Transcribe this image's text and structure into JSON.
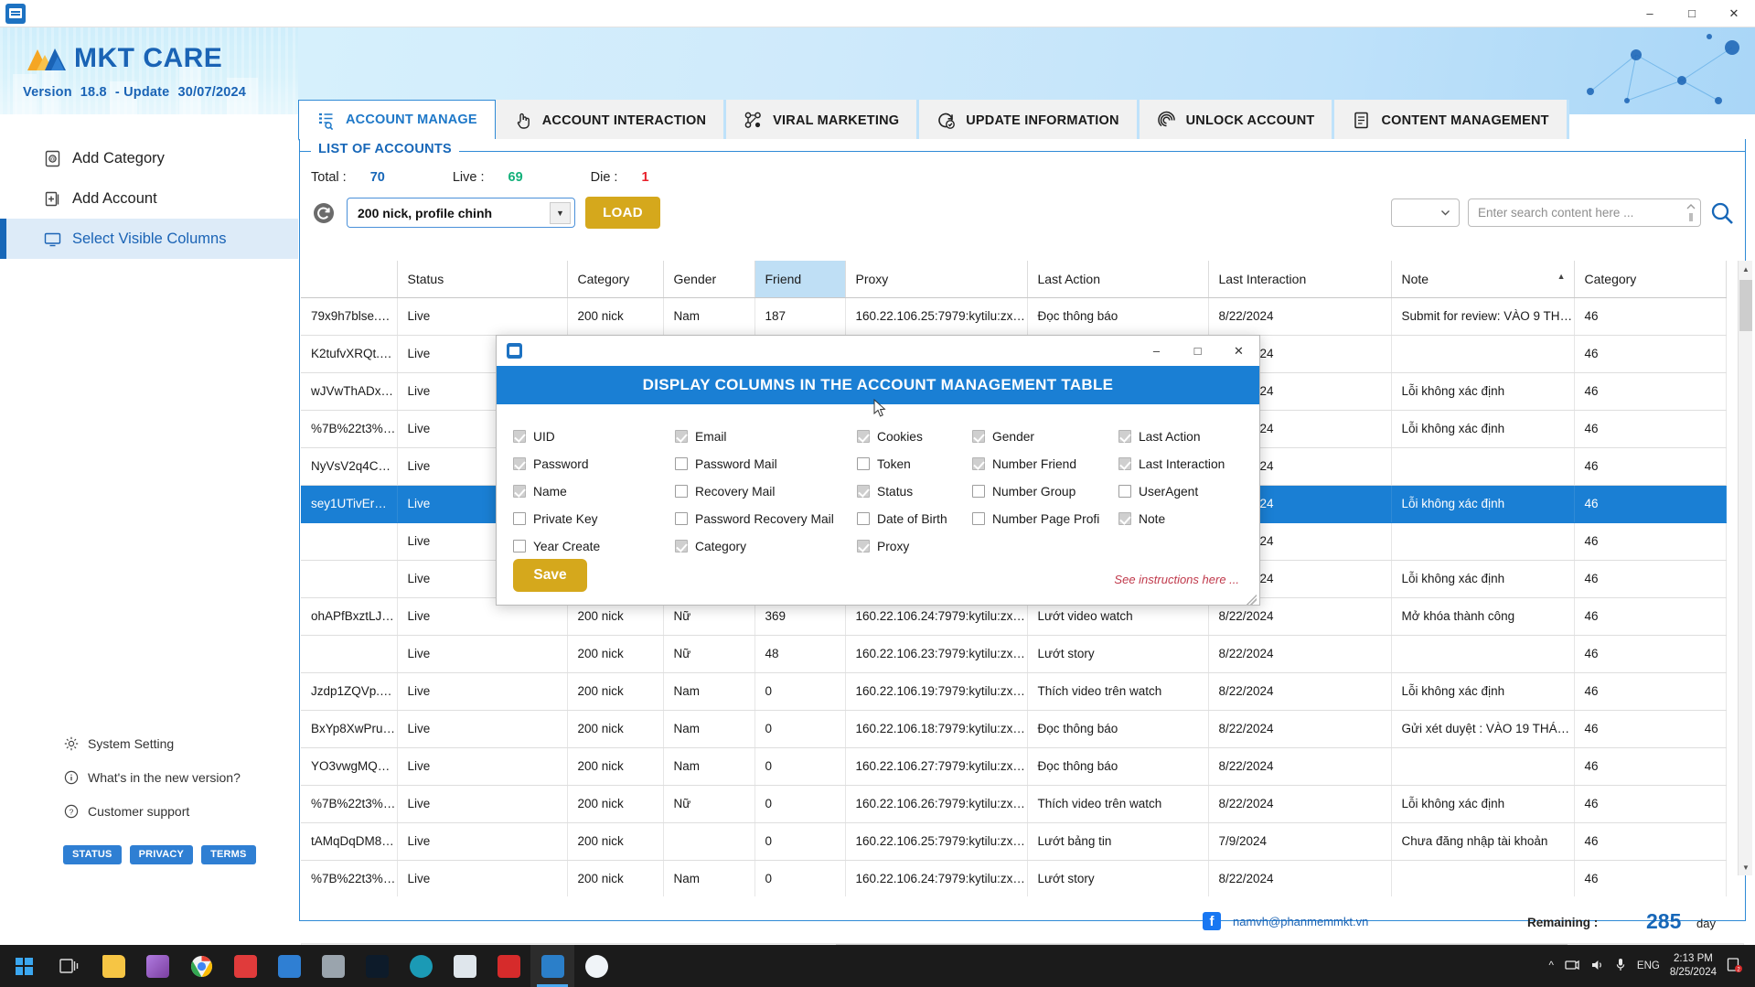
{
  "window": {
    "minimize": "–",
    "maximize": "□",
    "close": "✕"
  },
  "brand": {
    "name": "MKT CARE",
    "version_label": "Version",
    "version_number": "18.8",
    "update_label": "- Update",
    "update_date": "30/07/2024"
  },
  "sidebar": {
    "items": [
      {
        "label": "Add Category",
        "icon": "address-book-icon",
        "active": false
      },
      {
        "label": "Add Account",
        "icon": "add-box-icon",
        "active": false
      },
      {
        "label": "Select Visible Columns",
        "icon": "monitor-icon",
        "active": true
      }
    ],
    "bottom_items": [
      {
        "label": "System Setting",
        "icon": "gear-icon"
      },
      {
        "label": "What's in the new version?",
        "icon": "info-icon"
      },
      {
        "label": "Customer support",
        "icon": "question-icon"
      }
    ],
    "pills": [
      "STATUS",
      "PRIVACY",
      "TERMS"
    ]
  },
  "tabs": [
    {
      "label": "ACCOUNT MANAGE",
      "icon": "list-search-icon",
      "active": true
    },
    {
      "label": "ACCOUNT INTERACTION",
      "icon": "hand-pointer-icon",
      "active": false
    },
    {
      "label": "VIRAL MARKETING",
      "icon": "network-nodes-icon",
      "active": false
    },
    {
      "label": "UPDATE INFORMATION",
      "icon": "refresh-check-icon",
      "active": false
    },
    {
      "label": "UNLOCK ACCOUNT",
      "icon": "fingerprint-icon",
      "active": false
    },
    {
      "label": "CONTENT MANAGEMENT",
      "icon": "document-lines-icon",
      "active": false
    }
  ],
  "panel": {
    "legend": "LIST OF ACCOUNTS",
    "stats": {
      "total_label": "Total :",
      "total_value": "70",
      "live_label": "Live :",
      "live_value": "69",
      "die_label": "Die :",
      "die_value": "1"
    },
    "toolbar": {
      "refresh_icon": "refresh-icon",
      "category_select_value": "200 nick, profile chinh",
      "load_button": "LOAD"
    },
    "search": {
      "filter_value": "",
      "placeholder": "Enter search content here ...",
      "search_icon": "search-icon"
    }
  },
  "grid": {
    "columns": [
      "",
      "Status",
      "Category",
      "Gender",
      "Friend",
      "Proxy",
      "Last Action",
      "Last Interaction",
      "Note",
      "Category"
    ],
    "sorted_column": "Note",
    "sort_direction": "▲",
    "highlighted_column": "Friend",
    "rows": [
      {
        "uid": "79x9h7blse.AWWn...",
        "status": "Live",
        "category": "200 nick",
        "gender": "Nam",
        "friend": "187",
        "proxy": "160.22.106.25:7979:kytilu:zxwvj...",
        "last_action": "Đọc thông báo",
        "last_interaction": "8/22/2024",
        "note": "Submit for review: VÀO 9 THÁ...",
        "category2": "46",
        "selected": false
      },
      {
        "uid": "K2tufvXRQt.AWUP...",
        "status": "Live",
        "category": "",
        "gender": "",
        "friend": "",
        "proxy": "",
        "last_action": "",
        "last_interaction": "8/22/2024",
        "note": "",
        "category2": "46",
        "selected": false
      },
      {
        "uid": "wJVwThADx.AWV1...",
        "status": "Live",
        "category": "",
        "gender": "",
        "friend": "",
        "proxy": "",
        "last_action": "",
        "last_interaction": "8/22/2024",
        "note": "Lỗi không xác định",
        "category2": "46",
        "selected": false
      },
      {
        "uid": "%7B%22t3%22%3...",
        "status": "Live",
        "category": "",
        "gender": "",
        "friend": "",
        "proxy": "",
        "last_action": "",
        "last_interaction": "8/22/2024",
        "note": "Lỗi không xác định",
        "category2": "46",
        "selected": false
      },
      {
        "uid": "NyVsV2q4CR4.AW...",
        "status": "Live",
        "category": "",
        "gender": "",
        "friend": "",
        "proxy": "",
        "last_action": "",
        "last_interaction": "8/22/2024",
        "note": "",
        "category2": "46",
        "selected": false
      },
      {
        "uid": "sey1UTivErD.AWW...",
        "status": "Live",
        "category": "",
        "gender": "",
        "friend": "",
        "proxy": "",
        "last_action": "",
        "last_interaction": "8/22/2024",
        "note": "Lỗi không xác định",
        "category2": "46",
        "selected": true
      },
      {
        "uid": "",
        "status": "Live",
        "category": "",
        "gender": "",
        "friend": "",
        "proxy": "",
        "last_action": "",
        "last_interaction": "8/22/2024",
        "note": "",
        "category2": "46",
        "selected": false
      },
      {
        "uid": "",
        "status": "Live",
        "category": "",
        "gender": "",
        "friend": "",
        "proxy": "",
        "last_action": "",
        "last_interaction": "8/22/2024",
        "note": "Lỗi không xác định",
        "category2": "46",
        "selected": false
      },
      {
        "uid": "ohAPfBxztLJ.AWXz...",
        "status": "Live",
        "category": "200 nick",
        "gender": "Nữ",
        "friend": "369",
        "proxy": "160.22.106.24:7979:kytilu:zxwvj...",
        "last_action": "Lướt video watch",
        "last_interaction": "8/22/2024",
        "note": "Mở khóa thành công",
        "category2": "46",
        "selected": false
      },
      {
        "uid": "",
        "status": "Live",
        "category": "200 nick",
        "gender": "Nữ",
        "friend": "48",
        "proxy": "160.22.106.23:7979:kytilu:zxwvj...",
        "last_action": "Lướt story",
        "last_interaction": "8/22/2024",
        "note": "",
        "category2": "46",
        "selected": false
      },
      {
        "uid": "Jzdp1ZQVp.AWWk...",
        "status": "Live",
        "category": "200 nick",
        "gender": "Nam",
        "friend": "0",
        "proxy": "160.22.106.19:7979:kytilu:zxwvj...",
        "last_action": "Thích video trên watch",
        "last_interaction": "8/22/2024",
        "note": "Lỗi không xác định",
        "category2": "46",
        "selected": false
      },
      {
        "uid": "BxYp8XwPruv3A%3...",
        "status": "Live",
        "category": "200 nick",
        "gender": "Nam",
        "friend": "0",
        "proxy": "160.22.106.18:7979:kytilu:zxwvj...",
        "last_action": "Đọc thông báo",
        "last_interaction": "8/22/2024",
        "note": "Gửi xét duyệt : VÀO 19 THÁNG...",
        "category2": "46",
        "selected": false
      },
      {
        "uid": "YO3vwgMQa.AWV...",
        "status": "Live",
        "category": "200 nick",
        "gender": "Nam",
        "friend": "0",
        "proxy": "160.22.106.27:7979:kytilu:zxwvj...",
        "last_action": "Đọc thông báo",
        "last_interaction": "8/22/2024",
        "note": "",
        "category2": "46",
        "selected": false
      },
      {
        "uid": "%7B%22t3%22%3...",
        "status": "Live",
        "category": "200 nick",
        "gender": "Nữ",
        "friend": "0",
        "proxy": "160.22.106.26:7979:kytilu:zxwvj...",
        "last_action": "Thích video trên watch",
        "last_interaction": "8/22/2024",
        "note": "Lỗi không xác định",
        "category2": "46",
        "selected": false
      },
      {
        "uid": "tAMqDqDM8.AW...",
        "status": "Live",
        "category": "200 nick",
        "gender": "",
        "friend": "0",
        "proxy": "160.22.106.25:7979:kytilu:zxwvj...",
        "last_action": "Lướt bảng tin",
        "last_interaction": "7/9/2024",
        "note": "Chưa đăng nhập tài khoản",
        "category2": "46",
        "selected": false
      },
      {
        "uid": "%7B%22t3%22%3...",
        "status": "Live",
        "category": "200 nick",
        "gender": "Nam",
        "friend": "0",
        "proxy": "160.22.106.24:7979:kytilu:zxwvj...",
        "last_action": "Lướt story",
        "last_interaction": "8/22/2024",
        "note": "",
        "category2": "46",
        "selected": false
      }
    ]
  },
  "dialog": {
    "title": "DISPLAY COLUMNS IN THE ACCOUNT MANAGEMENT TABLE",
    "minimize": "–",
    "maximize": "□",
    "close": "✕",
    "save_label": "Save",
    "instructions_label": "See instructions here ...",
    "checkboxes": [
      {
        "label": "UID",
        "checked": true
      },
      {
        "label": "Email",
        "checked": true
      },
      {
        "label": "Cookies",
        "checked": true
      },
      {
        "label": "Gender",
        "checked": true
      },
      {
        "label": "Last Action",
        "checked": true
      },
      {
        "label": "Password",
        "checked": true
      },
      {
        "label": "Password Mail",
        "checked": false
      },
      {
        "label": "Token",
        "checked": false
      },
      {
        "label": "Number Friend",
        "checked": true
      },
      {
        "label": "Last Interaction",
        "checked": true
      },
      {
        "label": "Name",
        "checked": true
      },
      {
        "label": "Recovery Mail",
        "checked": false
      },
      {
        "label": "Status",
        "checked": true
      },
      {
        "label": "Number Group",
        "checked": false
      },
      {
        "label": "UserAgent",
        "checked": false
      },
      {
        "label": "Private Key",
        "checked": false
      },
      {
        "label": "Password Recovery Mail",
        "checked": false
      },
      {
        "label": "Date of Birth",
        "checked": false
      },
      {
        "label": "Number Page Profi",
        "checked": false
      },
      {
        "label": "Note",
        "checked": true
      },
      {
        "label": "Year Create",
        "checked": false
      },
      {
        "label": "Category",
        "checked": true
      },
      {
        "label": "Proxy",
        "checked": true
      },
      {
        "label": "",
        "checked": false
      },
      {
        "label": "",
        "checked": false
      }
    ]
  },
  "footer": {
    "email": "namvh@phanmemmkt.vn",
    "remaining_label": "Remaining :",
    "remaining_value": "285",
    "remaining_unit": "day"
  },
  "taskbar": {
    "language": "ENG",
    "time": "2:13 PM",
    "date": "8/25/2024",
    "notification_count": "2"
  },
  "colors": {
    "accent_blue": "#1767b8",
    "tab_active": "#1e78c8",
    "gold": "#d5a81c",
    "live_green": "#13b07a",
    "die_red": "#e8202a",
    "dialog_header": "#1a7fd4",
    "selection_blue": "#1a7fd4",
    "instruction_red": "#c0394b"
  }
}
